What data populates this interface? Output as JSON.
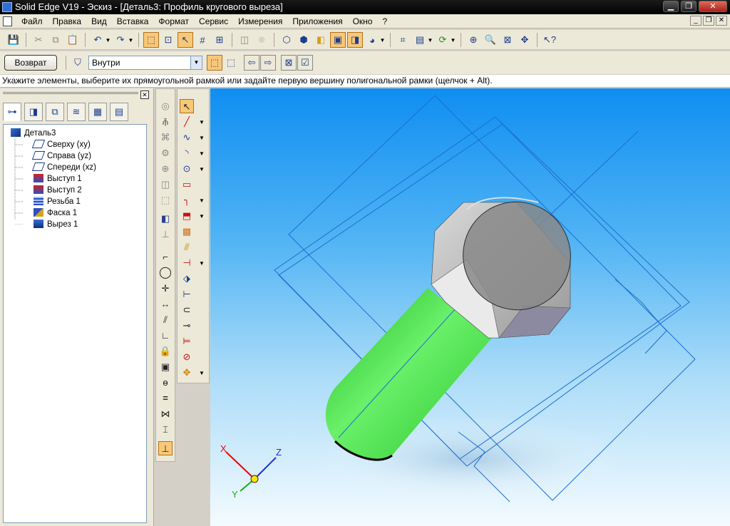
{
  "window": {
    "title": "Solid Edge V19 - Эскиз - [Деталь3: Профиль кругового выреза]",
    "min_label": "▁",
    "max_label": "❐",
    "close_label": "✕"
  },
  "menu": {
    "items": [
      "Файл",
      "Правка",
      "Вид",
      "Вставка",
      "Формат",
      "Сервис",
      "Измерения",
      "Приложения",
      "Окно",
      "?"
    ],
    "mdi_min": "_",
    "mdi_restore": "❐",
    "mdi_close": "✕"
  },
  "toolbar": {
    "return_label": "Возврат",
    "mode_value": "Внутри"
  },
  "prompt": {
    "text": "Укажите элементы, выберите их прямоугольной рамкой или задайте первую вершину полигональной рамки (щелчок + Alt)."
  },
  "pane": {
    "close_label": "✕"
  },
  "tree": {
    "root": "Деталь3",
    "items": [
      "Сверху (xy)",
      "Справа (yz)",
      "Спереди (xz)",
      "Выступ 1",
      "Выступ 2",
      "Резьба 1",
      "Фаска 1",
      "Вырез 1"
    ]
  },
  "triad": {
    "x": "X",
    "y": "Y",
    "z": "Z"
  },
  "colors": {
    "accent": "#f8c878",
    "thread": "#3ee23e",
    "sketch_lines": "#1c6fd0",
    "viewport_top": "#0f8ef2"
  }
}
